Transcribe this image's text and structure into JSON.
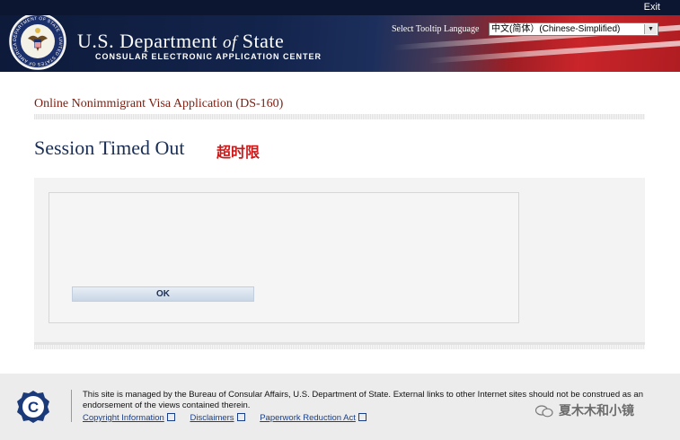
{
  "header": {
    "exit_label": "Exit",
    "dept_title_part1": "U.S. Department ",
    "dept_title_of": "of",
    "dept_title_part2": " State",
    "dept_subtitle": "CONSULAR ELECTRONIC APPLICATION CENTER",
    "seal_text": "DEPARTMENT OF STATE · UNITED STATES OF AMERICA",
    "tooltip_language_label": "Select Tooltip Language",
    "tooltip_language_value": "中文(简体）(Chinese-Simplified)"
  },
  "main": {
    "app_title": "Online Nonimmigrant Visa Application (DS-160)",
    "page_title": "Session Timed Out",
    "page_title_cn": "超时限",
    "ok_label": "OK"
  },
  "footer": {
    "logo_letter": "C",
    "disclaimer": "This site is managed by the Bureau of Consular Affairs, U.S. Department of State. External links to other Internet sites should not be construed as an endorsement of the views contained therein.",
    "links": {
      "copyright": "Copyright Information",
      "disclaimers": "Disclaimers",
      "paperwork": "Paperwork Reduction Act"
    }
  },
  "watermark_text": "夏木木和小镜",
  "colors": {
    "topbar": "#0c1630",
    "app_title": "#7a1d10",
    "page_title": "#1b2f55",
    "page_title_cn": "#cc1a1a",
    "link": "#1a3f8a"
  },
  "icons": {
    "seal": "department-seal-icon",
    "dropdown": "chevron-down-icon",
    "footer_logo": "consular-logo-icon",
    "external_link": "external-link-icon",
    "watermark": "wechat-icon"
  }
}
